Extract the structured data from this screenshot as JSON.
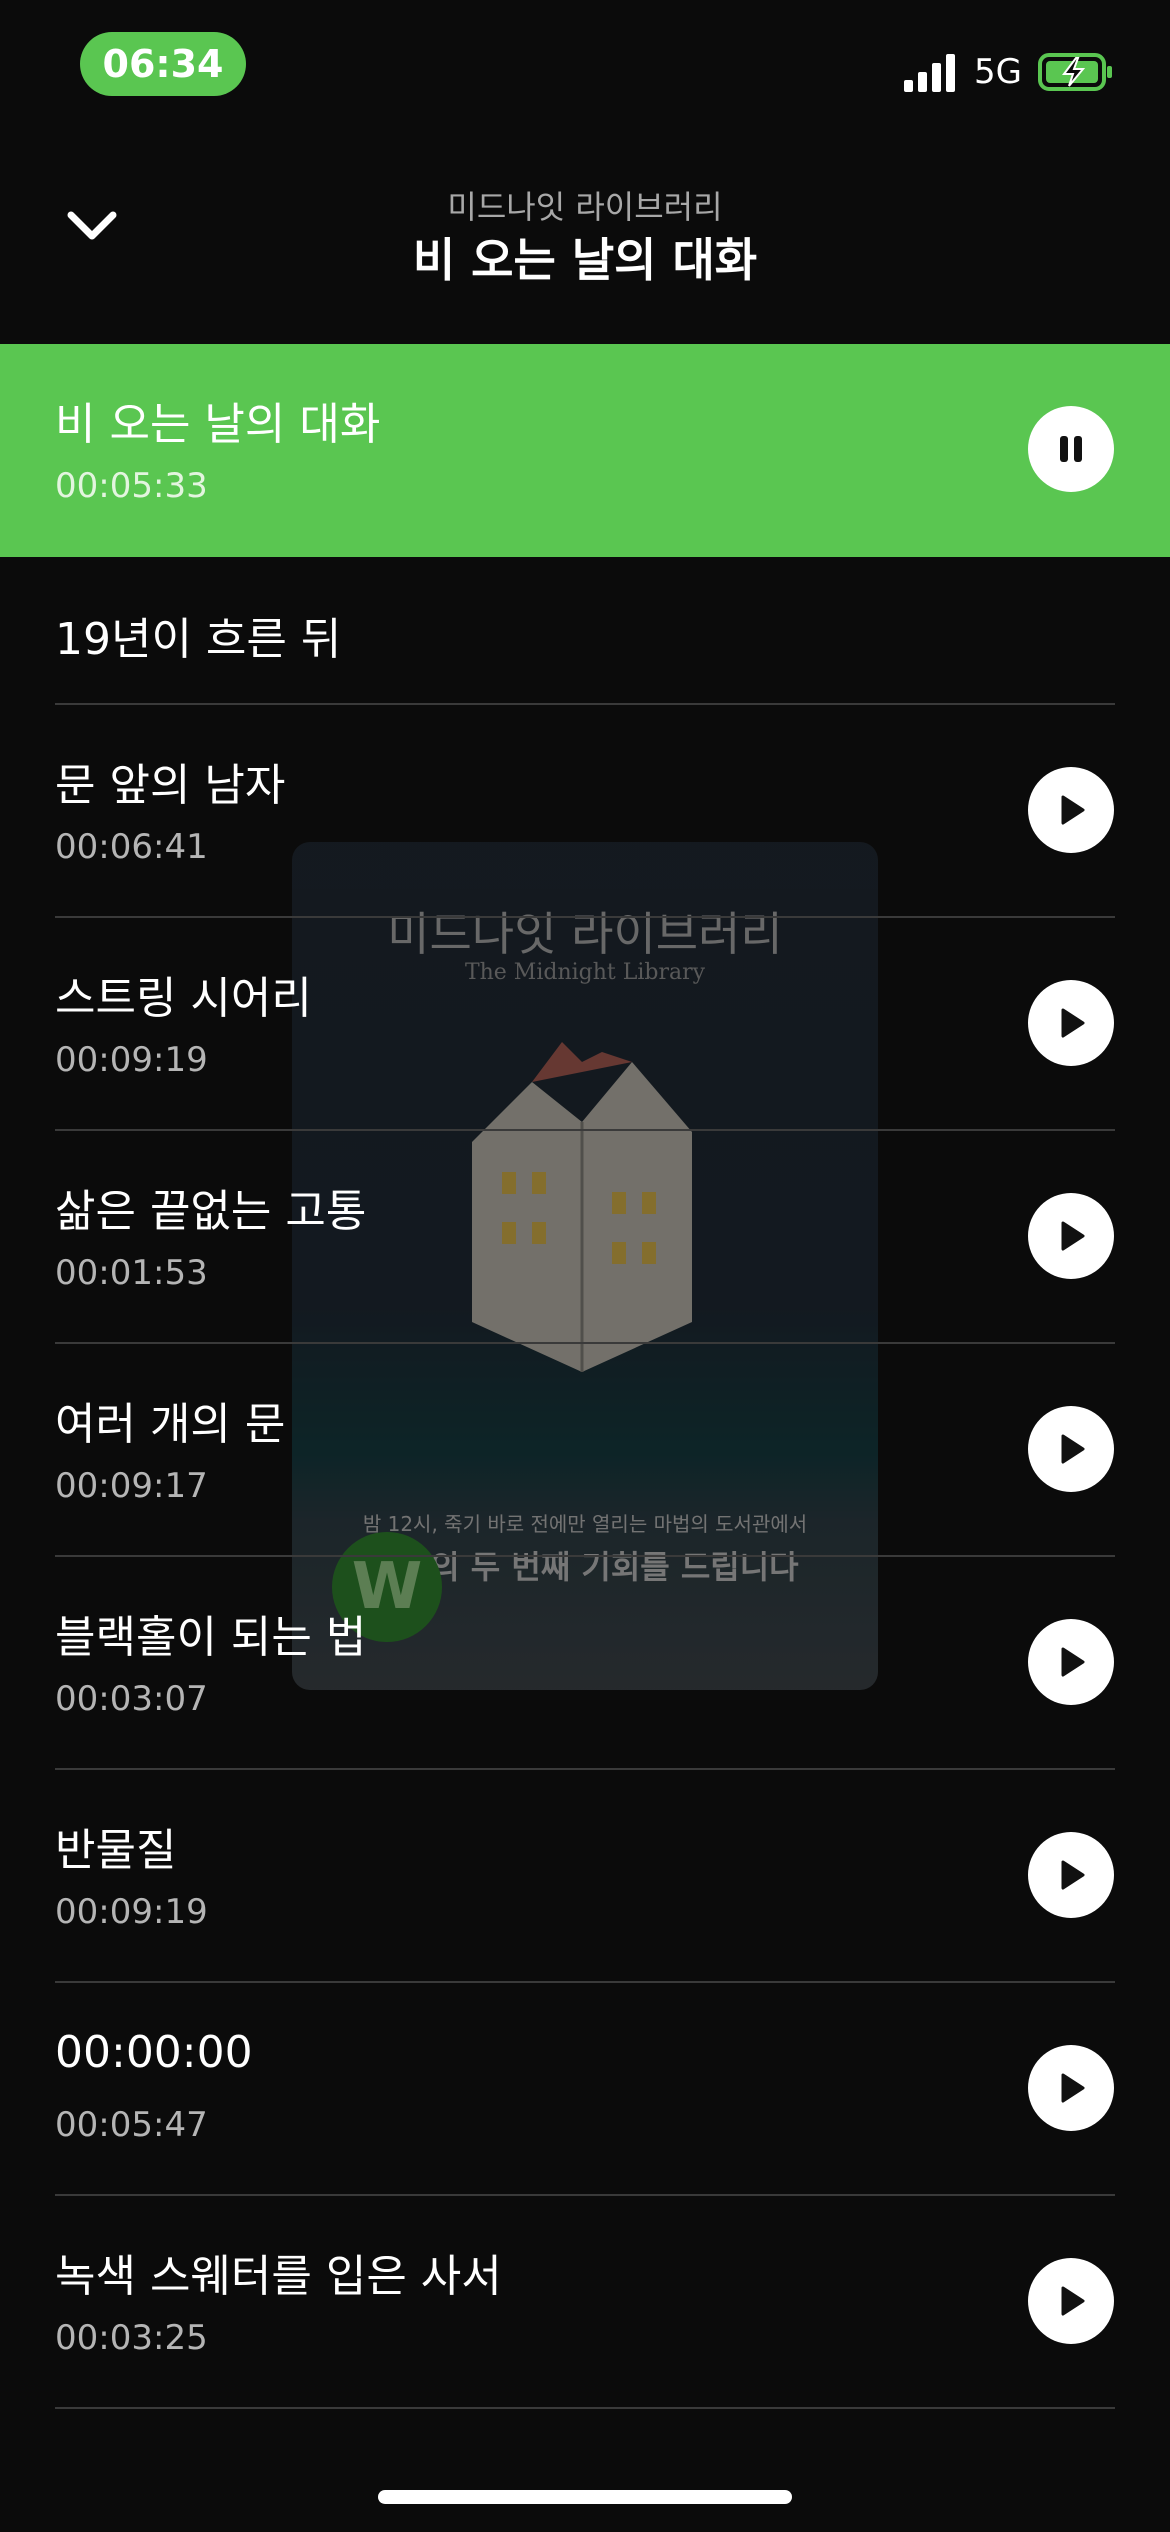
{
  "status_bar": {
    "time": "06:34",
    "network": "5G",
    "icons": [
      "signal-icon",
      "battery-charging-icon"
    ]
  },
  "header": {
    "book_title": "미드나잇 라이브러리",
    "current_chapter": "비 오는 날의 대화",
    "icons": [
      "chevron-down-icon"
    ]
  },
  "cover": {
    "title": "미드나잇 라이브러리",
    "subtitle": "The Midnight Library",
    "tagline": "밤 12시, 죽기 바로 전에만 열리는 마법의 도서관에서",
    "tagline_strong": "인생의 두 번째 기회를 드립니다",
    "logo_letter": "W"
  },
  "colors": {
    "accent": "#5ac651",
    "background": "#0b0b0b",
    "divider": "#3a3a3a"
  },
  "tracks": [
    {
      "title": "비 오는 날의 대화",
      "duration": "00:05:33",
      "state": "playing",
      "icon": "pause-icon"
    },
    {
      "title": "19년이 흐른 뒤",
      "duration": "",
      "state": "none",
      "icon": ""
    },
    {
      "title": "문 앞의 남자",
      "duration": "00:06:41",
      "state": "paused",
      "icon": "play-icon"
    },
    {
      "title": "스트링 시어리",
      "duration": "00:09:19",
      "state": "paused",
      "icon": "play-icon"
    },
    {
      "title": "삶은 끝없는 고통",
      "duration": "00:01:53",
      "state": "paused",
      "icon": "play-icon"
    },
    {
      "title": "여러 개의 문",
      "duration": "00:09:17",
      "state": "paused",
      "icon": "play-icon"
    },
    {
      "title": "블랙홀이 되는 법",
      "duration": "00:03:07",
      "state": "paused",
      "icon": "play-icon"
    },
    {
      "title": "반물질",
      "duration": "00:09:19",
      "state": "paused",
      "icon": "play-icon"
    },
    {
      "title": "00:00:00",
      "duration": "00:05:47",
      "state": "paused",
      "icon": "play-icon"
    },
    {
      "title": "녹색 스웨터를 입은 사서",
      "duration": "00:03:25",
      "state": "paused",
      "icon": "play-icon"
    }
  ]
}
